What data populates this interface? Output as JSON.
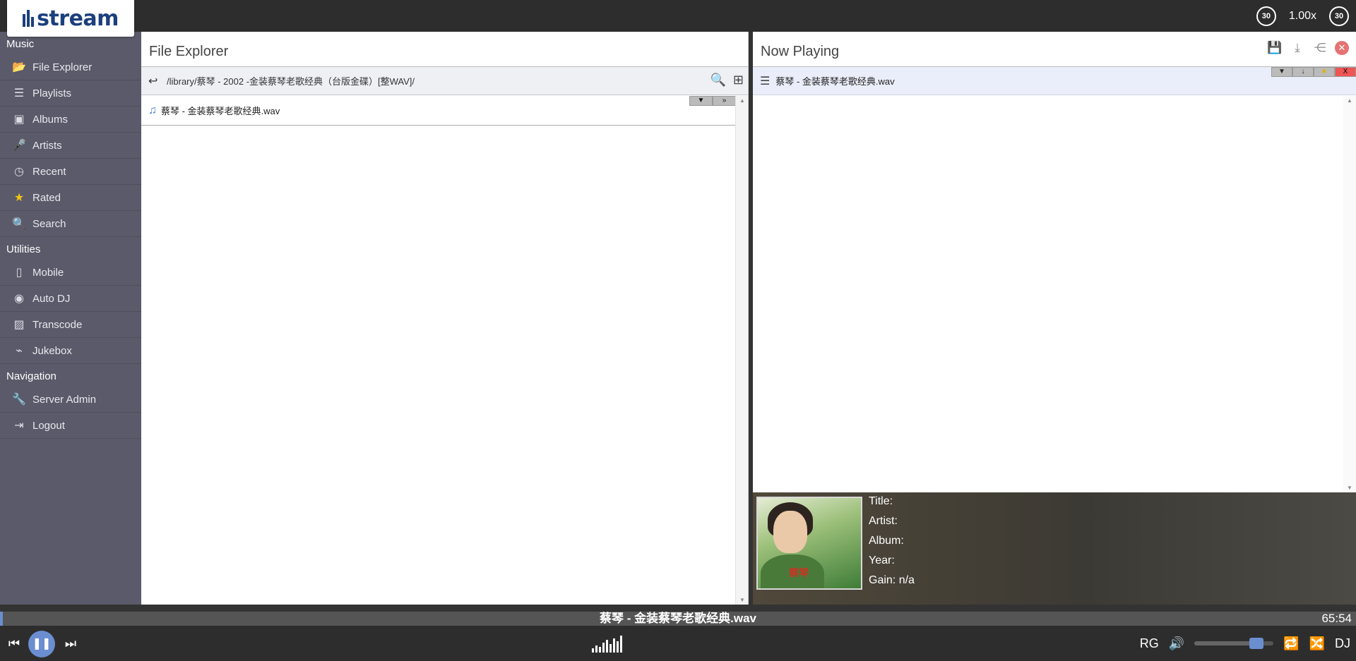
{
  "logo": {
    "text": "stream"
  },
  "topbar": {
    "back_icon_label": "30",
    "fwd_icon_label": "30",
    "speed": "1.00x"
  },
  "sidebar": {
    "sections": [
      {
        "title": "Music",
        "items": [
          {
            "label": "File Explorer",
            "icon": "folder-open-icon"
          },
          {
            "label": "Playlists",
            "icon": "playlist-icon"
          },
          {
            "label": "Albums",
            "icon": "album-icon"
          },
          {
            "label": "Artists",
            "icon": "microphone-icon"
          },
          {
            "label": "Recent",
            "icon": "clock-icon"
          },
          {
            "label": "Rated",
            "icon": "star-icon"
          },
          {
            "label": "Search",
            "icon": "search-icon"
          }
        ]
      },
      {
        "title": "Utilities",
        "items": [
          {
            "label": "Mobile",
            "icon": "mobile-icon"
          },
          {
            "label": "Auto DJ",
            "icon": "disc-icon"
          },
          {
            "label": "Transcode",
            "icon": "transcode-icon"
          },
          {
            "label": "Jukebox",
            "icon": "remote-icon"
          }
        ]
      },
      {
        "title": "Navigation",
        "items": [
          {
            "label": "Server Admin",
            "icon": "wrench-icon"
          },
          {
            "label": "Logout",
            "icon": "logout-icon"
          }
        ]
      }
    ]
  },
  "file_explorer": {
    "title": "File Explorer",
    "path": "/library/蔡琴 - 2002 -金装蔡琴老歌经典（台版金碟）[整WAV]/",
    "files": [
      {
        "name": "蔡琴 - 金装蔡琴老歌经典.wav"
      }
    ],
    "row_btn_add": "▼",
    "row_btn_more": "»"
  },
  "now_playing": {
    "title": "Now Playing",
    "queue": [
      {
        "name": "蔡琴 - 金装蔡琴老歌经典.wav"
      }
    ],
    "info": {
      "title_label": "Title:",
      "artist_label": "Artist:",
      "album_label": "Album:",
      "year_label": "Year:",
      "gain_label": "Gain: n/a"
    },
    "cover_text": "蔡琴"
  },
  "player": {
    "current_track": "蔡琴 - 金装蔡琴老歌经典.wav",
    "time": "65:54",
    "progress_fraction": 0.002,
    "volume_fraction": 0.85,
    "rg_label": "RG",
    "dj_label": "DJ"
  },
  "colors": {
    "accent": "#6a8ed0",
    "sidebar_bg": "#5a5a6a",
    "topbar_bg": "#2d2d2d"
  }
}
